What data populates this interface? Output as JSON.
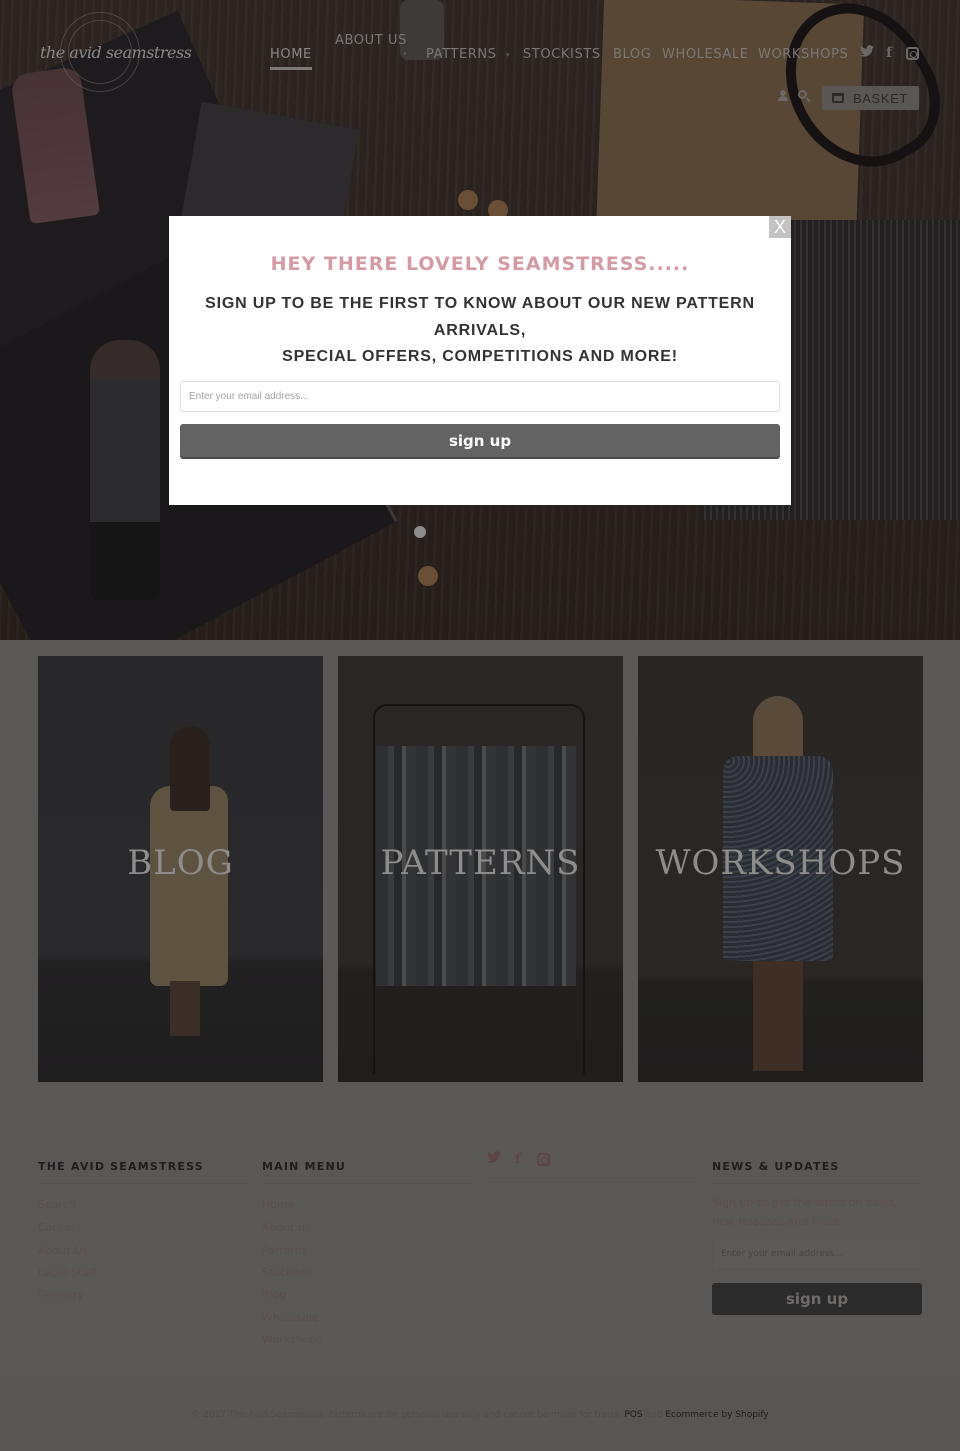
{
  "header": {
    "logo_text": "the avid seamstress",
    "nav": [
      {
        "label": "HOME",
        "active": true
      },
      {
        "label": "ABOUT US",
        "has_dropdown": true
      },
      {
        "label": "PATTERNS",
        "has_dropdown": true
      },
      {
        "label": "STOCKISTS"
      },
      {
        "label": "BLOG"
      },
      {
        "label": "WHOLESALE"
      },
      {
        "label": "WORKSHOPS"
      }
    ],
    "dropdown_caret": "▾",
    "social_icons": [
      "twitter-icon",
      "facebook-icon",
      "instagram-icon"
    ],
    "twitter_glyph": "🐦",
    "facebook_glyph": "f",
    "basket_label": "BASKET"
  },
  "popup": {
    "close_label": "X",
    "title": "HEY THERE LOVELY SEAMSTRESS.....",
    "subtitle_line1": "SIGN UP TO BE THE FIRST TO KNOW ABOUT OUR NEW PATTERN",
    "subtitle_line2": "ARRIVALS,",
    "subtitle_line3": "SPECIAL OFFERS, COMPETITIONS AND MORE!",
    "email_placeholder": "Enter your email address...",
    "signup_label": "sign up",
    "title_color": "#d49ba4"
  },
  "tiles": [
    {
      "label": "BLOG"
    },
    {
      "label": "PATTERNS"
    },
    {
      "label": "WORKSHOPS"
    }
  ],
  "footer": {
    "col1_title": "THE AVID SEAMSTRESS",
    "col1_links": [
      "Search",
      "Contact",
      "About Us",
      "Legal Stuff",
      "Delivery"
    ],
    "col2_title": "MAIN MENU",
    "col2_links": [
      "Home",
      "About us",
      "Patterns",
      "Stockists",
      "Blog",
      "Wholesale",
      "Workshops"
    ],
    "news_title": "NEWS & UPDATES",
    "news_text": "Sign up to get the latest on sales, new releases and more ...",
    "news_email_placeholder": "Enter your email address...",
    "news_signup_label": "sign up",
    "copyright_text": "© 2017 The Avid Seamstress. Patterns are for personal use only and cannot be made for trade.",
    "pos_link": "POS",
    "and_text": "and",
    "shopify_link": "Ecommerce by Shopify"
  }
}
